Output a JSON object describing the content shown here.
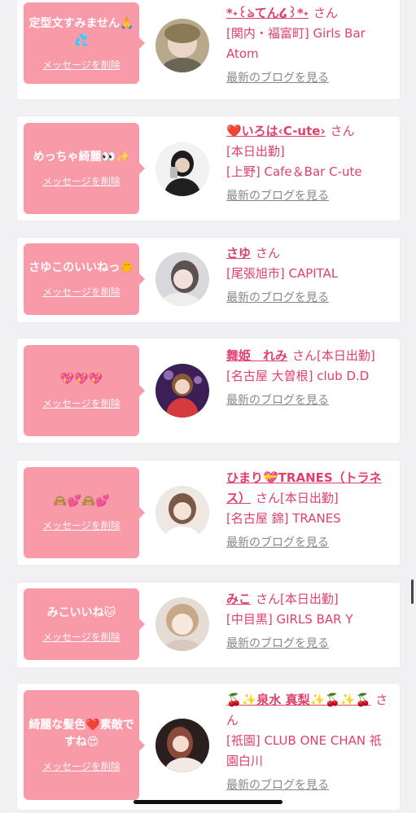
{
  "delete_label": "メッセージを削除",
  "blog_label": "最新のブログを見る",
  "honorific": "さん",
  "colors": {
    "bubble": "#f99aa8",
    "accent": "#e0406b",
    "background": "#f1f1f3"
  },
  "entries": [
    {
      "message": "定型文すみません🙏💦",
      "name": "*˖꒰ঌてん໒꒱*˖",
      "status": "",
      "lines": [
        "[関内・福富町] Girls Bar Atom"
      ]
    },
    {
      "message": "めっちゃ綺麗👀✨",
      "name": "❤️いろは‹C-ute›",
      "status": "",
      "lines": [
        "[本日出勤]",
        "[上野] Cafe＆Bar C-ute"
      ]
    },
    {
      "message": "さゆこのいいねっ🐥",
      "name": "さゆ",
      "status": "",
      "lines": [
        "[尾張旭市] CAPITAL"
      ]
    },
    {
      "message": "💖💖💖",
      "name": "舞姫　れみ",
      "status": "[本日出勤]",
      "lines": [
        "[名古屋 大曽根] club D.D"
      ]
    },
    {
      "message": "🙈💕🙈💕",
      "name": "ひまり💝TRANES（トラネス）",
      "status": "[本日出勤]",
      "lines": [
        "[名古屋 錦] TRANES"
      ]
    },
    {
      "message": "みこいいね🐱",
      "name": "みこ",
      "status": "[本日出勤]",
      "lines": [
        "[中目黒] GIRLS BAR Y"
      ]
    },
    {
      "message": "綺麗な髪色❤️素敵ですね😍",
      "name": "🍒✨泉水 真梨✨🍒✨🍒",
      "status": "",
      "lines": [
        "[祇園] CLUB ONE CHAN 祇園白川"
      ]
    }
  ]
}
